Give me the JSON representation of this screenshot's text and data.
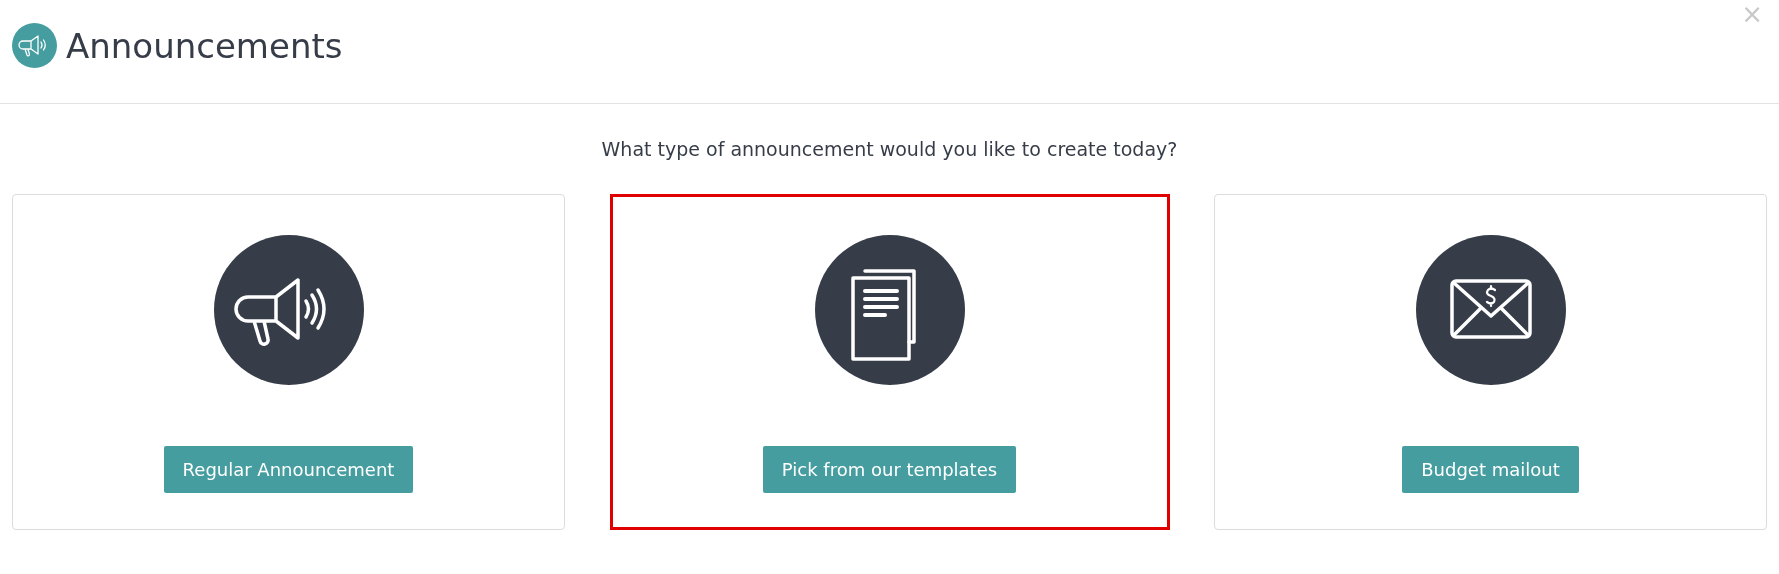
{
  "header": {
    "title": "Announcements",
    "close": "×"
  },
  "question": "What type of announcement would you like to create today?",
  "options": [
    {
      "kind": "megaphone",
      "button": "Regular Announcement",
      "selected": false
    },
    {
      "kind": "documents",
      "button": "Pick from our templates",
      "selected": true
    },
    {
      "kind": "envelope",
      "button": "Budget mailout",
      "selected": false
    }
  ]
}
